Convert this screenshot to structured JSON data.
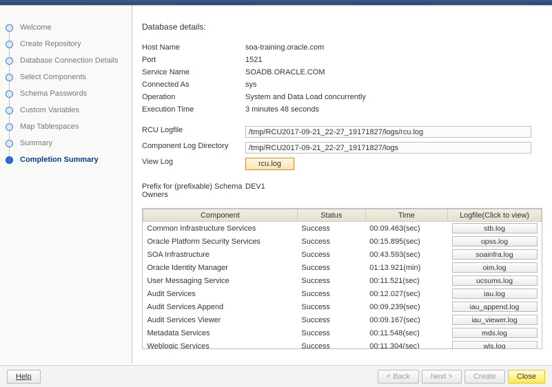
{
  "sidebar": {
    "steps": [
      {
        "label": "Welcome"
      },
      {
        "label": "Create Repository"
      },
      {
        "label": "Database Connection Details"
      },
      {
        "label": "Select Components"
      },
      {
        "label": "Schema Passwords"
      },
      {
        "label": "Custom Variables"
      },
      {
        "label": "Map Tablespaces"
      },
      {
        "label": "Summary"
      },
      {
        "label": "Completion Summary"
      }
    ],
    "active_index": 8
  },
  "content": {
    "title": "Database details:",
    "details": {
      "host_label": "Host Name",
      "host": "soa-training.oracle.com",
      "port_label": "Port",
      "port": "1521",
      "service_label": "Service Name",
      "service": "SOADB.ORACLE.COM",
      "connected_label": "Connected As",
      "connected": "sys",
      "operation_label": "Operation",
      "operation": "System and Data Load concurrently",
      "exec_label": "Execution Time",
      "exec": "3  minutes 48  seconds",
      "rcu_log_label": "RCU Logfile",
      "rcu_log_value": "/tmp/RCU2017-09-21_22-27_19171827/logs/rcu.log",
      "comp_log_label": "Component Log Directory",
      "comp_log_value": "/tmp/RCU2017-09-21_22-27_19171827/logs",
      "view_log_label": "View Log",
      "view_log_btn": "rcu.log",
      "prefix_label": "Prefix for (prefixable) Schema Owners",
      "prefix_value": "DEV1"
    },
    "table": {
      "headers": {
        "c": "Component",
        "s": "Status",
        "t": "Time",
        "l": "Logfile(Click to view)"
      },
      "rows": [
        {
          "comp": "Common Infrastructure Services",
          "status": "Success",
          "time": "00:09.463(sec)",
          "log": "stb.log"
        },
        {
          "comp": "Oracle Platform Security Services",
          "status": "Success",
          "time": "00:15.895(sec)",
          "log": "opss.log"
        },
        {
          "comp": "SOA Infrastructure",
          "status": "Success",
          "time": "00:43.593(sec)",
          "log": "soainfra.log"
        },
        {
          "comp": "Oracle Identity Manager",
          "status": "Success",
          "time": "01:13.921(min)",
          "log": "oim.log"
        },
        {
          "comp": "User Messaging Service",
          "status": "Success",
          "time": "00:11.521(sec)",
          "log": "ucsums.log"
        },
        {
          "comp": "Audit Services",
          "status": "Success",
          "time": "00:12.027(sec)",
          "log": "iau.log"
        },
        {
          "comp": "Audit Services Append",
          "status": "Success",
          "time": "00:09.239(sec)",
          "log": "iau_append.log"
        },
        {
          "comp": "Audit Services Viewer",
          "status": "Success",
          "time": "00:09.167(sec)",
          "log": "iau_viewer.log"
        },
        {
          "comp": "Metadata Services",
          "status": "Success",
          "time": "00:11.548(sec)",
          "log": "mds.log"
        },
        {
          "comp": "Weblogic Services",
          "status": "Success",
          "time": "00:11.304(sec)",
          "log": "wls.log"
        }
      ]
    }
  },
  "footer": {
    "help": "Help",
    "back": "< Back",
    "next": "Next >",
    "create": "Create",
    "close": "Close"
  }
}
